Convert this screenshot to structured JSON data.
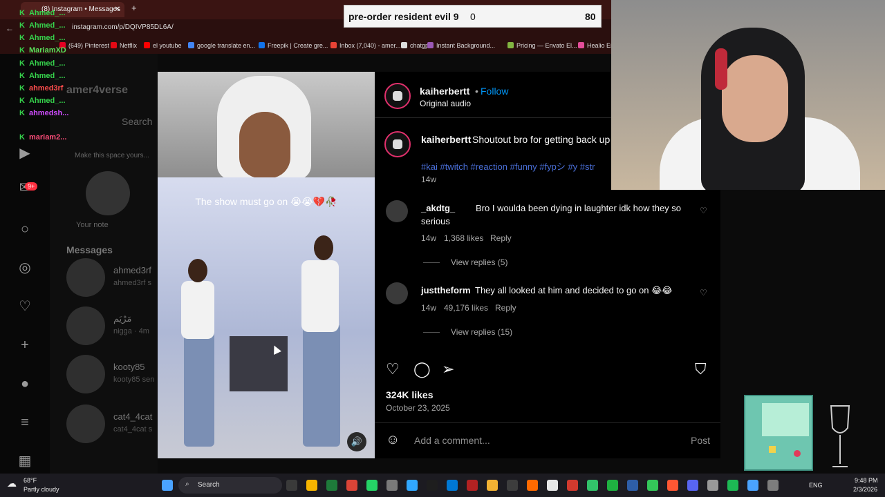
{
  "browser": {
    "tab_title": "(8) Instagram • Messages",
    "url": "instagram.com/p/DQIVP85DL6A/",
    "bookmarks": [
      {
        "label": "(649) Pinterest",
        "color": "#e60023"
      },
      {
        "label": "Netflix",
        "color": "#e50914"
      },
      {
        "label": "el youtube",
        "color": "#ff0000"
      },
      {
        "label": "google translate en...",
        "color": "#4285f4"
      },
      {
        "label": "Freepik | Create gre...",
        "color": "#1273eb"
      },
      {
        "label": "Inbox (7,040) - amer...",
        "color": "#ea4335"
      },
      {
        "label": "chatgpt",
        "color": "#dddddd"
      },
      {
        "label": "Instant Background...",
        "color": "#9b59b6"
      },
      {
        "label": "Pricing — Envato El...",
        "color": "#82b541"
      },
      {
        "label": "Healio Er",
        "color": "#e44d9a"
      }
    ]
  },
  "overlay_search": {
    "query": "pre-order resident evil 9",
    "count": "0",
    "score": "80"
  },
  "chat": [
    {
      "name": "Ahmed_...",
      "color": "#36d34c"
    },
    {
      "name": "Ahmed_...",
      "color": "#36d34c"
    },
    {
      "name": "Ahmed_...",
      "color": "#36d34c"
    },
    {
      "name": "MariamXD",
      "color": "#5be35b"
    },
    {
      "name": "Ahmed_...",
      "color": "#36d34c"
    },
    {
      "name": "Ahmed_...",
      "color": "#36d34c"
    },
    {
      "name": "ahmed3rf",
      "color": "#ff4d4d"
    },
    {
      "name": "Ahmed_...",
      "color": "#36d34c"
    },
    {
      "name": "ahmedsh...",
      "color": "#d04dff"
    },
    {
      "name": "mariam2...",
      "color": "#ff4d7a"
    }
  ],
  "dm": {
    "account": "amer4verse",
    "search_placeholder": "Search",
    "note_prompt": "Make this space yours...",
    "your_note": "Your note",
    "messages_header": "Messages",
    "threads": [
      {
        "name": "ahmed3rf",
        "preview": "ahmed3rf s"
      },
      {
        "name": "مَرْيَم",
        "preview": "nigga · 4m"
      },
      {
        "name": "kooty85",
        "preview": "kooty85 sen"
      },
      {
        "name": "cat4_4cat",
        "preview": "cat4_4cat s"
      }
    ],
    "badge": "9+"
  },
  "post": {
    "username": "kaiherbertt",
    "follow": "Follow",
    "audio": "Original audio",
    "caption_user": "kaiherbertt",
    "caption": "Shoutout bro for getting back up",
    "hashtags": "#kai #twitch #reaction #funny #fypシ #y #str",
    "caption_age": "14w",
    "video_caption": "The show must go on 😭😭💔🥀",
    "likes": "324K likes",
    "date": "October 23, 2025",
    "comment_placeholder": "Add a comment...",
    "post_button": "Post",
    "comments": [
      {
        "user": "_akdtg_",
        "text": "Bro I woulda been dying in laughter idk how they so",
        "text2": "serious",
        "age": "14w",
        "likes": "1,368 likes",
        "reply": "Reply",
        "view_replies": "View replies (5)"
      },
      {
        "user": "justtheform",
        "text": "They all looked at him and decided to go on 😂😂",
        "age": "14w",
        "likes": "49,176 likes",
        "reply": "Reply",
        "view_replies": "View replies (15)"
      }
    ]
  },
  "taskbar": {
    "weather_temp": "68°F",
    "weather_desc": "Partly cloudy",
    "search": "Search",
    "lang": "ENG",
    "time": "9:48 PM",
    "date": "2/3/2026"
  }
}
